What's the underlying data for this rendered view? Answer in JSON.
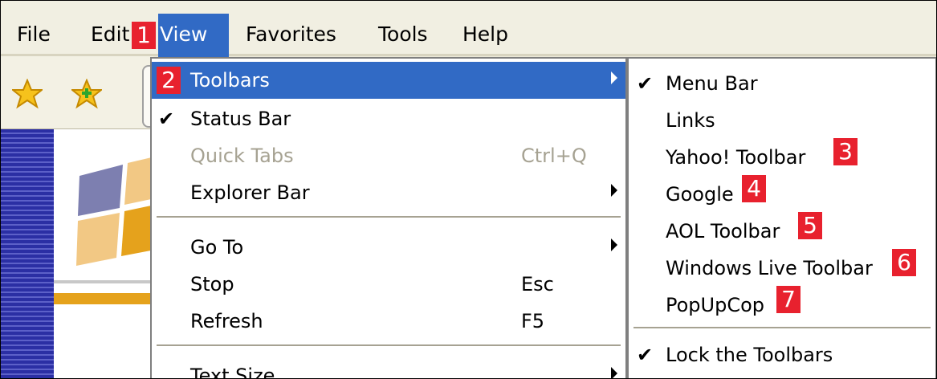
{
  "menubar": {
    "file": "File",
    "edit": "Edit",
    "view": "View",
    "favorites": "Favorites",
    "tools": "Tools",
    "help": "Help"
  },
  "badges": [
    "1",
    "2",
    "3",
    "4",
    "5",
    "6",
    "7"
  ],
  "view_menu": {
    "toolbars": "Toolbars",
    "status_bar": "Status Bar",
    "quick_tabs": "Quick Tabs",
    "quick_tabs_shortcut": "Ctrl+Q",
    "explorer_bar": "Explorer Bar",
    "go_to": "Go To",
    "stop": "Stop",
    "stop_shortcut": "Esc",
    "refresh": "Refresh",
    "refresh_shortcut": "F5",
    "text_size": "Text Size"
  },
  "toolbars_submenu": {
    "menu_bar": "Menu Bar",
    "links": "Links",
    "yahoo": "Yahoo! Toolbar",
    "google": "Google",
    "aol": "AOL Toolbar",
    "windows_live": "Windows Live Toolbar",
    "popupcop": "PopUpCop",
    "lock": "Lock the Toolbars"
  },
  "checkmark": "✔",
  "colors": {
    "highlight": "#316ac5",
    "badge": "#e8212e",
    "disabled_text": "#a6a292"
  },
  "icons": [
    "favorites-star-icon",
    "add-favorites-icon",
    "submenu-arrow-icon",
    "checkmark-icon"
  ]
}
